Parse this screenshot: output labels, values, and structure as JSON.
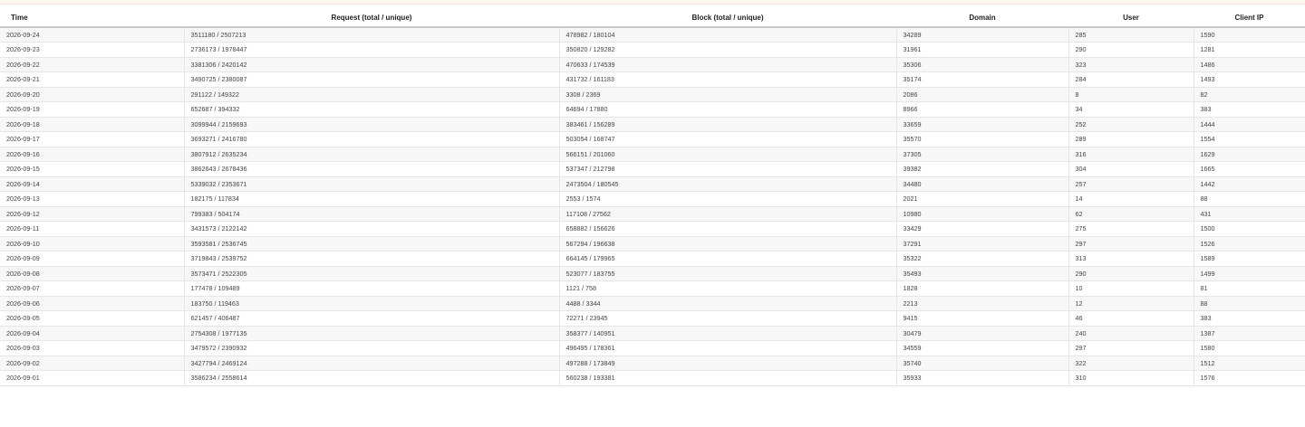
{
  "table": {
    "headers": [
      "Time",
      "Request (total / unique)",
      "Block (total / unique)",
      "Domain",
      "User",
      "Client IP"
    ],
    "rows": [
      [
        "2026-09-24",
        "3511180 / 2507213",
        "478982 / 180104",
        "34289",
        "285",
        "1590"
      ],
      [
        "2026-09-23",
        "2736173 / 1978447",
        "350820 / 129282",
        "31961",
        "290",
        "1281"
      ],
      [
        "2026-09-22",
        "3381306 / 2420142",
        "470633 / 174539",
        "35306",
        "323",
        "1486"
      ],
      [
        "2026-09-21",
        "3490725 / 2380087",
        "431732 / 161183",
        "35174",
        "284",
        "1493"
      ],
      [
        "2026-09-20",
        "291122 / 149322",
        "3308 / 2369",
        "2086",
        "8",
        "82"
      ],
      [
        "2026-09-19",
        "652687 / 394332",
        "64694 / 17880",
        "8966",
        "34",
        "383"
      ],
      [
        "2026-09-18",
        "3099944 / 2159693",
        "383461 / 156289",
        "33659",
        "252",
        "1444"
      ],
      [
        "2026-09-17",
        "3693271 / 2416780",
        "503054 / 168747",
        "35570",
        "289",
        "1554"
      ],
      [
        "2026-09-16",
        "3807912 / 2635234",
        "566151 / 201060",
        "37305",
        "316",
        "1629"
      ],
      [
        "2026-09-15",
        "3862643 / 2678436",
        "537347 / 212798",
        "39382",
        "304",
        "1665"
      ],
      [
        "2026-09-14",
        "5339032 / 2353671",
        "2473504 / 180545",
        "34480",
        "257",
        "1442"
      ],
      [
        "2026-09-13",
        "182175 / 117834",
        "2553 / 1574",
        "2021",
        "14",
        "88"
      ],
      [
        "2026-09-12",
        "799383 / 504174",
        "117108 / 27562",
        "10980",
        "62",
        "431"
      ],
      [
        "2026-09-11",
        "3431573 / 2122142",
        "658882 / 156626",
        "33429",
        "275",
        "1500"
      ],
      [
        "2026-09-10",
        "3593581 / 2536745",
        "567294 / 196638",
        "37291",
        "297",
        "1526"
      ],
      [
        "2026-09-09",
        "3719843 / 2539752",
        "664145 / 179965",
        "35322",
        "313",
        "1589"
      ],
      [
        "2026-09-08",
        "3573471 / 2522305",
        "523077 / 183755",
        "35493",
        "290",
        "1499"
      ],
      [
        "2026-09-07",
        "177478 / 109489",
        "1121 / 758",
        "1828",
        "10",
        "81"
      ],
      [
        "2026-09-06",
        "183750 / 119463",
        "4488 / 3344",
        "2213",
        "12",
        "88"
      ],
      [
        "2026-09-05",
        "621457 / 406487",
        "72271 / 23945",
        "9415",
        "46",
        "383"
      ],
      [
        "2026-09-04",
        "2754308 / 1977135",
        "358377 / 140951",
        "30479",
        "240",
        "1387"
      ],
      [
        "2026-09-03",
        "3479572 / 2390932",
        "496495 / 178361",
        "34559",
        "297",
        "1580"
      ],
      [
        "2026-09-02",
        "3427794 / 2469124",
        "497288 / 173849",
        "35740",
        "322",
        "1512"
      ],
      [
        "2026-09-01",
        "3586234 / 2558614",
        "560238 / 193381",
        "35933",
        "310",
        "1576"
      ]
    ]
  }
}
